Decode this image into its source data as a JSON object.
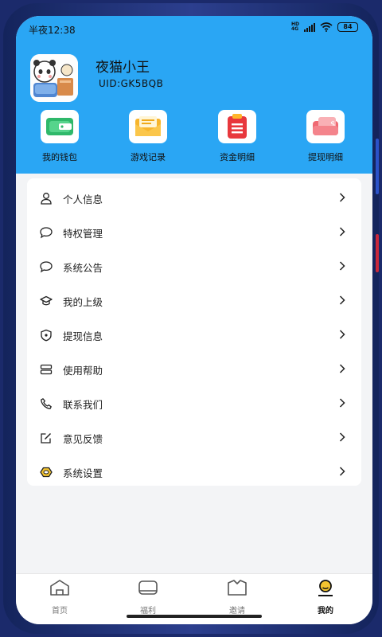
{
  "status_bar": {
    "time": "半夜12:38",
    "battery": "84"
  },
  "profile": {
    "name": "夜猫小王",
    "uid_label": "UID:",
    "uid": "GK5BQB"
  },
  "shortcuts": [
    {
      "label": "我的钱包",
      "icon": "wallet-icon"
    },
    {
      "label": "游戏记录",
      "icon": "envelope-icon"
    },
    {
      "label": "资金明细",
      "icon": "ledger-icon"
    },
    {
      "label": "提现明细",
      "icon": "withdraw-card-icon"
    }
  ],
  "menu": [
    {
      "label": "个人信息",
      "icon": "person-icon"
    },
    {
      "label": "特权管理",
      "icon": "chat-bubble-icon"
    },
    {
      "label": "系统公告",
      "icon": "chat-bubble-icon"
    },
    {
      "label": "我的上级",
      "icon": "graduation-cap-icon"
    },
    {
      "label": "提现信息",
      "icon": "shield-icon"
    },
    {
      "label": "使用帮助",
      "icon": "server-icon"
    },
    {
      "label": "联系我们",
      "icon": "phone-icon"
    },
    {
      "label": "意见反馈",
      "icon": "edit-icon"
    },
    {
      "label": "系统设置",
      "icon": "hexagon-settings-icon"
    }
  ],
  "tabs": [
    {
      "label": "首页",
      "icon": "home-icon"
    },
    {
      "label": "福利",
      "icon": "gift-icon"
    },
    {
      "label": "邀请",
      "icon": "invite-icon"
    },
    {
      "label": "我的",
      "icon": "profile-icon",
      "active": true
    }
  ],
  "colors": {
    "header": "#2aa6f4",
    "background": "#f3f4f6",
    "card": "#ffffff"
  }
}
